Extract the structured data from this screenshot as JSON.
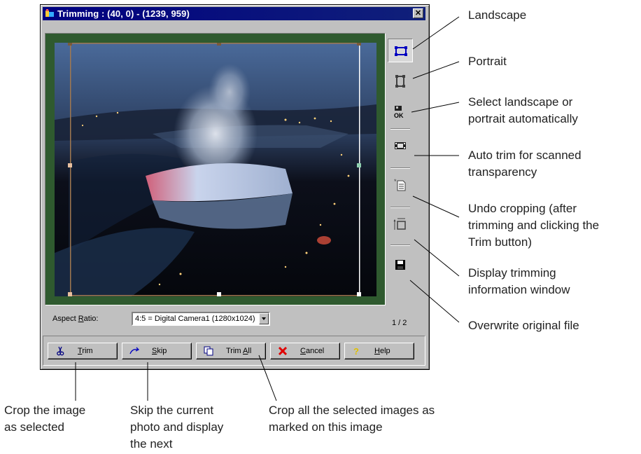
{
  "window": {
    "title": "Trimming : (40, 0) - (1239, 959)",
    "close_glyph": "✕"
  },
  "aspect": {
    "label_pre": "Aspect ",
    "label_key": "R",
    "label_post": "atio:",
    "selected": "4:5  = Digital Camera1 (1280x1024)"
  },
  "page_counter": "1 / 2",
  "toolbar": [
    {
      "name": "landscape",
      "icon": "landscape-icon"
    },
    {
      "name": "portrait",
      "icon": "portrait-icon"
    },
    {
      "name": "auto-orientation",
      "icon": "auto-orientation-icon"
    },
    {
      "name": "auto-trim",
      "icon": "film-trim-icon"
    },
    {
      "name": "undo-crop",
      "icon": "undo-crop-icon"
    },
    {
      "name": "trim-info",
      "icon": "trim-info-icon"
    },
    {
      "name": "overwrite",
      "icon": "floppy-disk-icon"
    }
  ],
  "buttons": {
    "trim": {
      "key": "T",
      "rest": "rim",
      "icon": "scissors-icon"
    },
    "skip": {
      "key": "S",
      "rest": "kip",
      "icon": "skip-arrow-icon"
    },
    "trim_all": {
      "pre": "Trim ",
      "key": "A",
      "rest": "ll",
      "icon": "copy-pages-icon"
    },
    "cancel": {
      "key": "C",
      "rest": "ancel",
      "icon": "red-x-icon"
    },
    "help": {
      "key": "H",
      "rest": "elp",
      "icon": "question-icon"
    }
  },
  "callouts": {
    "landscape": "Landscape",
    "portrait": "Portrait",
    "auto_select_1": "Select landscape or",
    "auto_select_2": "portrait automatically",
    "auto_trim_1": "Auto trim for scanned",
    "auto_trim_2": "transparency",
    "undo_1": "Undo cropping (after",
    "undo_2": "trimming and clicking the",
    "undo_3": "Trim button)",
    "display_1": "Display trimming",
    "display_2": "information window",
    "overwrite": "Overwrite original file",
    "crop_1": "Crop the image",
    "crop_2": "as selected",
    "skip_1": "Skip the current",
    "skip_2": "photo and display",
    "skip_3": "the next",
    "cropall_1": "Crop all the selected images as",
    "cropall_2": "marked on this image"
  },
  "colors": {
    "title_bar": "#000080",
    "dialog_face": "#c0c0c0",
    "frame_green": "#2f5a2f",
    "crop_line": "#a07850"
  }
}
